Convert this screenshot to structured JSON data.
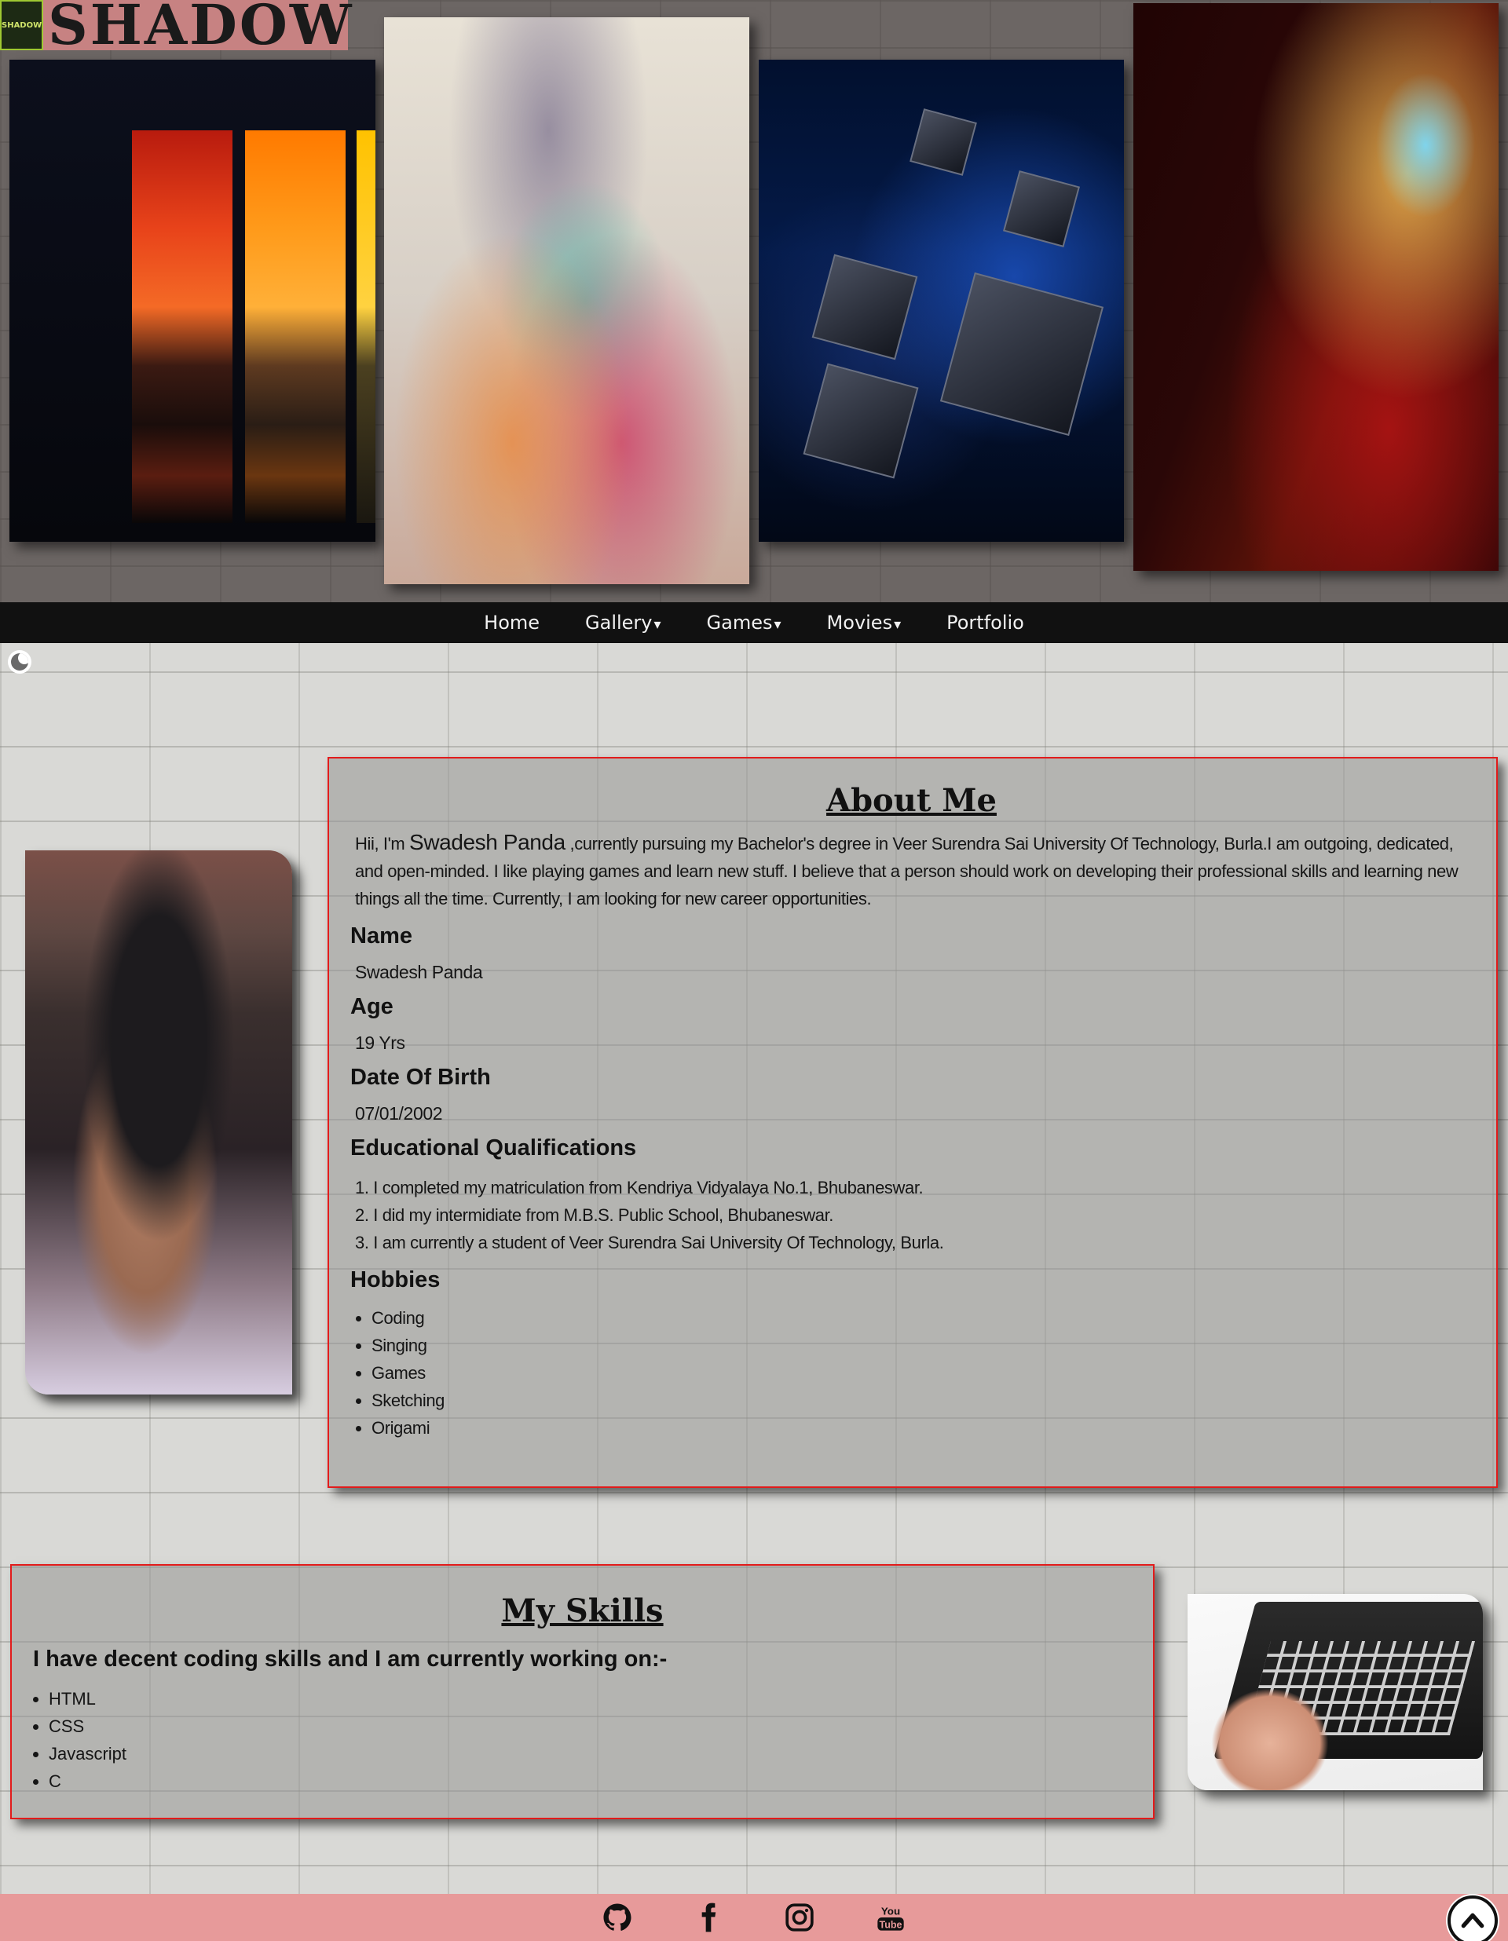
{
  "header": {
    "logo_badge_text": "SHADOW",
    "logo_text": "SHADOW"
  },
  "nav": {
    "items": [
      {
        "label": "Home",
        "has_dropdown": false
      },
      {
        "label": "Gallery",
        "has_dropdown": true
      },
      {
        "label": "Games",
        "has_dropdown": true
      },
      {
        "label": "Movies",
        "has_dropdown": true
      },
      {
        "label": "Portfolio",
        "has_dropdown": false
      }
    ],
    "caret": "▾"
  },
  "about": {
    "title": "About Me",
    "intro_prefix": "Hii, I'm ",
    "intro_name": "Swadesh Panda",
    "intro_suffix": " ,currently pursuing my Bachelor's degree in Veer Surendra Sai University Of Technology, Burla.I am outgoing, dedicated, and open-minded. I like playing games and learn new stuff. I believe that a person should work on developing their professional skills and learning new things all the time. Currently, I am looking for new career opportunities.",
    "name_label": "Name",
    "name_value": "Swadesh Panda",
    "age_label": "Age",
    "age_value": "19 Yrs",
    "dob_label": "Date Of Birth",
    "dob_value": "07/01/2002",
    "edu_label": "Educational Qualifications",
    "edu_items": [
      "I completed my matriculation from Kendriya Vidyalaya No.1, Bhubaneswar.",
      "I did my intermidiate from M.B.S. Public School, Bhubaneswar.",
      "I am currently a student of Veer Surendra Sai University Of Technology, Burla."
    ],
    "hobbies_label": "Hobbies",
    "hobbies": [
      "Coding",
      "Singing",
      "Games",
      "Sketching",
      "Origami"
    ]
  },
  "skills": {
    "title": "My Skills",
    "lead": "I have decent coding skills and I am currently working on:-",
    "items": [
      "HTML",
      "CSS",
      "Javascript",
      "C"
    ]
  },
  "footer": {
    "icons": [
      "github-icon",
      "facebook-icon",
      "instagram-icon",
      "youtube-icon"
    ],
    "youtube_word_top": "You",
    "youtube_word_bottom": "Tube"
  },
  "colors": {
    "accent_border": "#e21b1b",
    "footer_bg": "#e79a9a",
    "navbar_bg": "#111111",
    "logo_bg": "#c78282"
  }
}
